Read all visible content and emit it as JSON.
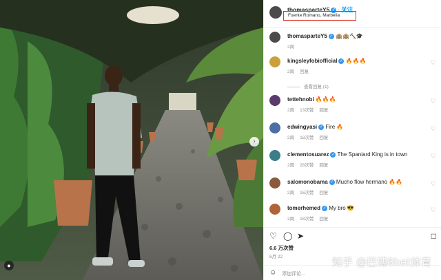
{
  "post": {
    "username": "thomasparteY5",
    "follow_label": "关注",
    "location": "Fuente Romano, Marbella",
    "caption_user": "thomasparteY5",
    "caption_text": "🏨🏨🔨🎓",
    "caption_time": "2周"
  },
  "comments": [
    {
      "user": "kingsleyfobiofficial",
      "verified": true,
      "text": "🔥🔥🔥",
      "time": "2周",
      "likes": "",
      "reply": "回复",
      "view_replies": "查看回复 (1)",
      "avatar_color": "#c9a03a"
    },
    {
      "user": "tettehnobi",
      "verified": false,
      "text": "🔥🔥🔥",
      "time": "2周",
      "likes": "13次赞",
      "reply": "回复",
      "avatar_color": "#5b3a6e"
    },
    {
      "user": "edwingyasi",
      "verified": true,
      "text": "Fire 🔥",
      "time": "2周",
      "likes": "18次赞",
      "reply": "回复",
      "avatar_color": "#4a6fa5"
    },
    {
      "user": "clementosuarez",
      "verified": true,
      "text": "The Spaniard King is in town",
      "time": "2周",
      "likes": "28次赞",
      "reply": "回复",
      "avatar_color": "#3b7e8a"
    },
    {
      "user": "salomonobama",
      "verified": true,
      "text": "Mucho flow hermano 🔥🔥",
      "time": "2周",
      "likes": "16次赞",
      "reply": "回复",
      "avatar_color": "#8a5a3b"
    },
    {
      "user": "tomerhemed",
      "verified": true,
      "text": "My bro 😎",
      "time": "2周",
      "likes": "18次赞",
      "reply": "回复",
      "avatar_color": "#b0633a"
    }
  ],
  "stats": {
    "likes": "6.6 万次赞",
    "date": "6月 22"
  },
  "composer": {
    "placeholder": "添加评论..."
  },
  "watermark": "知乎 @巴博8bet体育",
  "icons": {
    "like": "heart-icon",
    "comment": "comment-icon",
    "share": "send-icon",
    "save": "bookmark-icon",
    "emoji": "emoji-icon",
    "tag": "user-tag-icon",
    "next": "chevron-right-icon"
  },
  "colors": {
    "accent": "#0095f6",
    "verified": "#3897f0",
    "highlight_box": "#d8362b",
    "muted": "#8e8e8e"
  }
}
